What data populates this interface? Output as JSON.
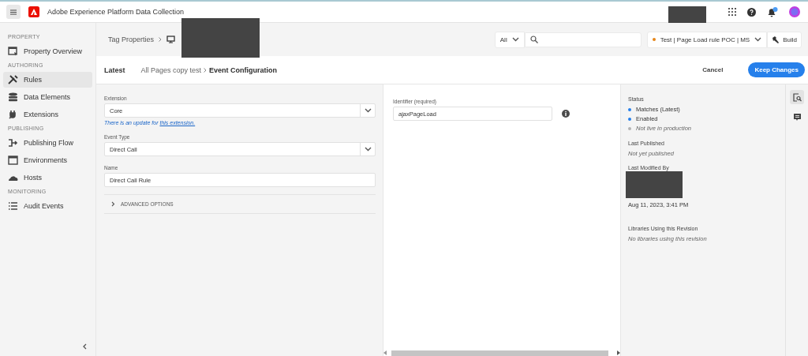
{
  "app": {
    "title": "Adobe Experience Platform Data Collection"
  },
  "sidebar": {
    "sections": [
      {
        "heading": "PROPERTY",
        "items": [
          {
            "label": "Property Overview",
            "selected": false
          }
        ]
      },
      {
        "heading": "AUTHORING",
        "items": [
          {
            "label": "Rules",
            "selected": true
          },
          {
            "label": "Data Elements",
            "selected": false
          },
          {
            "label": "Extensions",
            "selected": false
          }
        ]
      },
      {
        "heading": "PUBLISHING",
        "items": [
          {
            "label": "Publishing Flow",
            "selected": false
          },
          {
            "label": "Environments",
            "selected": false
          },
          {
            "label": "Hosts",
            "selected": false
          }
        ]
      },
      {
        "heading": "MONITORING",
        "items": [
          {
            "label": "Audit Events",
            "selected": false
          }
        ]
      }
    ]
  },
  "header": {
    "breadcrumb": "Tag Properties",
    "search_scope": "All",
    "library": "Test | Page Load rule POC | MS",
    "build": "Build"
  },
  "toolbar": {
    "revision": "Latest",
    "crumbs": [
      "All Pages copy test",
      "Event Configuration"
    ],
    "cancel": "Cancel",
    "confirm": "Keep Changes"
  },
  "form": {
    "extension": {
      "label": "Extension",
      "value": "Core"
    },
    "note_text": "There is an update for ",
    "note_link": "this extension.",
    "event_type": {
      "label": "Event Type",
      "value": "Direct Call"
    },
    "name": {
      "label": "Name",
      "value": "Direct Call Rule"
    },
    "advanced": {
      "label": "ADVANCED OPTIONS",
      "expanded": false
    }
  },
  "identifier": {
    "label": "Identifier (required)",
    "value": "ajaxPageLoad"
  },
  "details": {
    "status_heading": "Status",
    "status": [
      {
        "label": "Matches (Latest)",
        "color": "#2680eb",
        "muted": false
      },
      {
        "label": "Enabled",
        "color": "#2680eb",
        "muted": false
      },
      {
        "label": "Not live in production",
        "color": "#b3b3b3",
        "muted": true
      }
    ],
    "published_label": "Last Published",
    "published_value": "Not yet published",
    "modified_label": "Last Modified By",
    "modified_date": "Aug 11, 2023, 3:41 PM",
    "libraries_label": "Libraries Using this Revision",
    "libraries_value": "No libraries using this revision"
  }
}
